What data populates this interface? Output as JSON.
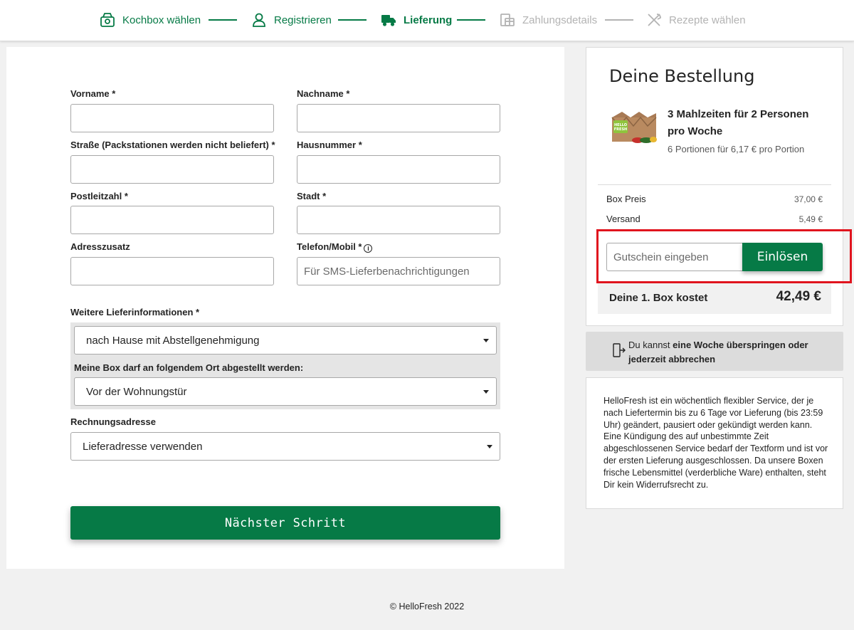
{
  "steps": [
    {
      "label": "Kochbox wählen",
      "state": "done",
      "icon": "box-icon"
    },
    {
      "label": "Registrieren",
      "state": "done",
      "icon": "user-icon"
    },
    {
      "label": "Lieferung",
      "state": "active",
      "icon": "truck-icon"
    },
    {
      "label": "Zahlungsdetails",
      "state": "todo",
      "icon": "payment-icon"
    },
    {
      "label": "Rezepte wählen",
      "state": "todo",
      "icon": "cutlery-icon"
    }
  ],
  "form": {
    "first_name_label": "Vorname *",
    "first_name_value": "",
    "last_name_label": "Nachname *",
    "last_name_value": "",
    "street_label": "Straße (Packstationen werden nicht beliefert) *",
    "street_value": "",
    "house_number_label": "Hausnummer *",
    "house_number_value": "",
    "zip_label": "Postleitzahl *",
    "zip_value": "",
    "city_label": "Stadt *",
    "city_value": "",
    "address_extra_label": "Adresszusatz",
    "address_extra_value": "",
    "phone_label": "Telefon/Mobil *",
    "phone_placeholder": "Für SMS-Lieferbenachrichtigungen",
    "phone_value": "",
    "delivery_info_label": "Weitere Lieferinformationen *",
    "delivery_info_selected": "nach Hause mit Abstellgenehmigung",
    "dropoff_label": "Meine Box darf an folgendem Ort abgestellt werden:",
    "dropoff_selected": "Vor der Wohnungstür",
    "billing_label": "Rechnungsadresse",
    "billing_selected": "Lieferadresse verwenden",
    "next_button": "Nächster Schritt"
  },
  "order": {
    "title": "Deine Bestellung",
    "plan_title": "3 Mahlzeiten für 2 Personen pro Woche",
    "plan_subtitle": "6 Portionen für 6,17 € pro Portion",
    "box_price_label": "Box Preis",
    "box_price_value": "37,00 €",
    "shipping_label": "Versand",
    "shipping_value": "5,49 €",
    "voucher_placeholder": "Gutschein eingeben",
    "voucher_button": "Einlösen",
    "total_label": "Deine 1. Box kostet",
    "total_value": "42,49 €"
  },
  "skip_banner": {
    "prefix": "Du kannst ",
    "bold": "eine Woche überspringen oder jederzeit abbrechen"
  },
  "legal_text": "HelloFresh ist ein wöchentlich flexibler Service, der je nach Liefertermin bis zu 6 Tage vor Lieferung (bis 23:59 Uhr) geändert, pausiert oder gekündigt werden kann. Eine Kündigung des auf unbestimmte Zeit abgeschlossenen Service bedarf der Textform und ist vor der ersten Lieferung ausgeschlossen. Da unsere Boxen frische Lebensmittel (verderbliche Ware) enthalten, steht Dir kein Widerrufsrecht zu.",
  "footer": "© HelloFresh 2022",
  "colors": {
    "brand_green": "#067a46",
    "inactive_grey": "#b3b3b3",
    "highlight_red": "#e0141e"
  }
}
